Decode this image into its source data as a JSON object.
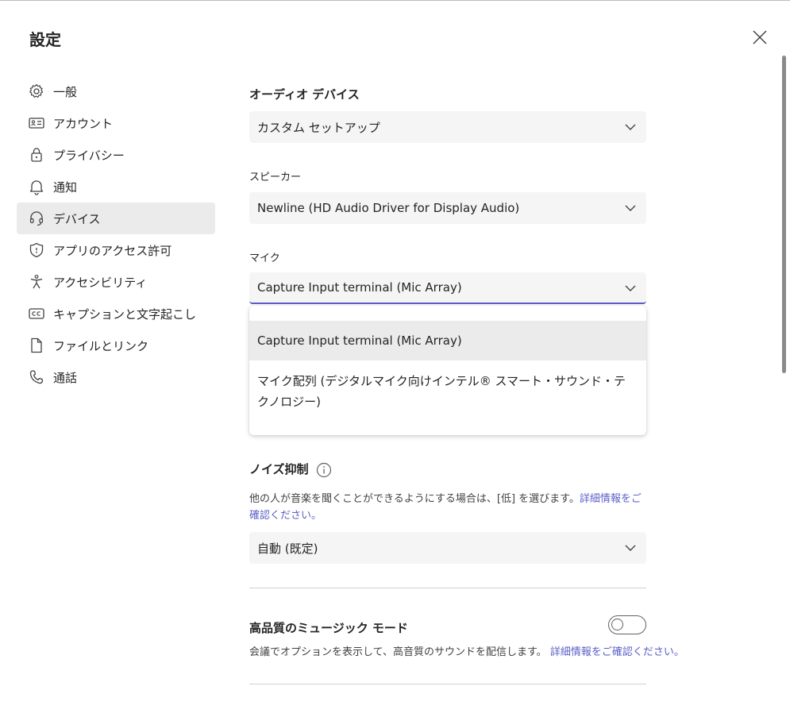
{
  "window": {
    "title": "設定"
  },
  "sidebar": {
    "items": [
      {
        "label": "一般",
        "icon": "gear-icon"
      },
      {
        "label": "アカウント",
        "icon": "id-card-icon"
      },
      {
        "label": "プライバシー",
        "icon": "lock-icon"
      },
      {
        "label": "通知",
        "icon": "bell-icon"
      },
      {
        "label": "デバイス",
        "icon": "headset-icon",
        "active": true
      },
      {
        "label": "アプリのアクセス許可",
        "icon": "shield-icon"
      },
      {
        "label": "アクセシビリティ",
        "icon": "accessibility-icon"
      },
      {
        "label": "キャプションと文字起こし",
        "icon": "cc-icon"
      },
      {
        "label": "ファイルとリンク",
        "icon": "document-icon"
      },
      {
        "label": "通話",
        "icon": "phone-icon"
      }
    ]
  },
  "audio": {
    "section_title": "オーディオ デバイス",
    "device_value": "カスタム セットアップ",
    "speaker_label": "スピーカー",
    "speaker_value": "Newline (HD Audio Driver for Display Audio)",
    "mic_label": "マイク",
    "mic_value": "Capture Input terminal (Mic Array)"
  },
  "mic_menu": {
    "options": [
      "Capture Input terminal (Mic Array)",
      "マイク配列 (デジタルマイク向けインテル® スマート・サウンド・テクノロジー)"
    ]
  },
  "noise": {
    "title": "ノイズ抑制",
    "description": "他の人が音楽を聞くことができるようにする場合は、[低] を選びます。",
    "link": "詳細情報をご確認ください。",
    "value": "自動 (既定)"
  },
  "music_mode": {
    "title": "高品質のミュージック モード",
    "description": "会議でオプションを表示して、高音質のサウンドを配信します。",
    "link": "詳細情報をご確認ください。",
    "enabled": false
  },
  "colors": {
    "accent": "#5b5fc7",
    "selected_bg": "#ebebeb",
    "field_bg": "#f5f5f5"
  }
}
